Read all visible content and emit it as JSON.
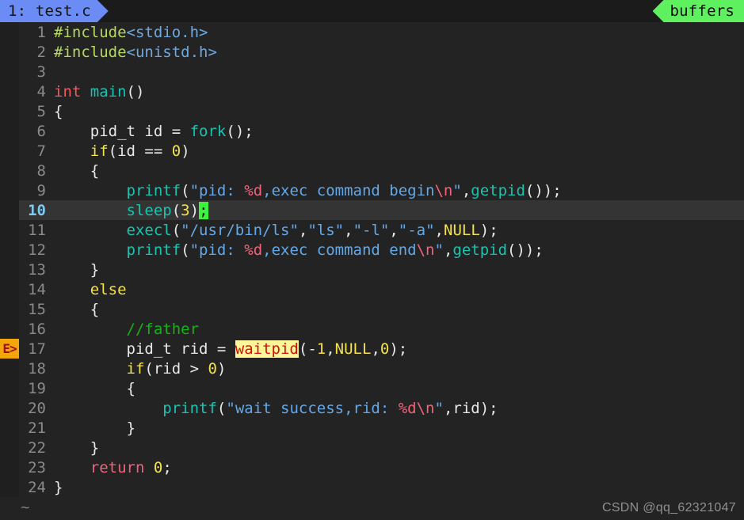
{
  "editor": {
    "name": "vim",
    "colors": {
      "background": "#232323",
      "tabline_background": "#1b1b1b",
      "active_tab": "#6b8cf5",
      "buffers_tab": "#5ff05f",
      "cursor": "#3ff03f",
      "cursorline": "#343434",
      "error_sign_bg": "#f2a60c",
      "error_highlight_bg": "#fff799",
      "error_highlight_fg": "#d01010",
      "line_number": "#8a8a8a",
      "current_line_number": "#7ec8f2"
    }
  },
  "tabline": {
    "active_tab_label": "1: test.c",
    "buffers_label": "buffers"
  },
  "gutter": {
    "error_sign": "E>",
    "error_sign_line": 17,
    "empty_marker": "~"
  },
  "cursor": {
    "line": 10,
    "char": ";"
  },
  "lines": [
    {
      "n": "1",
      "tokens": [
        {
          "t": "#include",
          "c": "s-pre"
        },
        {
          "t": "<stdio.h>",
          "c": "s-header"
        }
      ]
    },
    {
      "n": "2",
      "tokens": [
        {
          "t": "#include",
          "c": "s-pre"
        },
        {
          "t": "<unistd.h>",
          "c": "s-header"
        }
      ]
    },
    {
      "n": "3",
      "tokens": []
    },
    {
      "n": "4",
      "tokens": [
        {
          "t": "int",
          "c": "s-type"
        },
        {
          "t": " ",
          "c": "s-punct"
        },
        {
          "t": "main",
          "c": "s-func"
        },
        {
          "t": "()",
          "c": "s-punct"
        }
      ]
    },
    {
      "n": "5",
      "tokens": [
        {
          "t": "{",
          "c": "s-brace"
        }
      ]
    },
    {
      "n": "6",
      "tokens": [
        {
          "t": "    pid_t id ",
          "c": "s-ident"
        },
        {
          "t": "= ",
          "c": "s-punct"
        },
        {
          "t": "fork",
          "c": "s-func"
        },
        {
          "t": "();",
          "c": "s-punct"
        }
      ]
    },
    {
      "n": "7",
      "tokens": [
        {
          "t": "    ",
          "c": "s-punct"
        },
        {
          "t": "if",
          "c": "s-kw"
        },
        {
          "t": "(id == ",
          "c": "s-punct"
        },
        {
          "t": "0",
          "c": "s-num"
        },
        {
          "t": ")",
          "c": "s-punct"
        }
      ]
    },
    {
      "n": "8",
      "tokens": [
        {
          "t": "    {",
          "c": "s-brace"
        }
      ]
    },
    {
      "n": "9",
      "tokens": [
        {
          "t": "        ",
          "c": "s-punct"
        },
        {
          "t": "printf",
          "c": "s-func"
        },
        {
          "t": "(",
          "c": "s-punct"
        },
        {
          "t": "\"pid: ",
          "c": "s-str"
        },
        {
          "t": "%d",
          "c": "s-fmt"
        },
        {
          "t": ",exec command begin",
          "c": "s-str"
        },
        {
          "t": "\\n",
          "c": "s-fmt"
        },
        {
          "t": "\"",
          "c": "s-str"
        },
        {
          "t": ",",
          "c": "s-punct"
        },
        {
          "t": "getpid",
          "c": "s-func"
        },
        {
          "t": "());",
          "c": "s-punct"
        }
      ]
    },
    {
      "n": "10",
      "cursorline": true,
      "tokens": [
        {
          "t": "        ",
          "c": "s-punct"
        },
        {
          "t": "sleep",
          "c": "s-func"
        },
        {
          "t": "(",
          "c": "s-punct"
        },
        {
          "t": "3",
          "c": "s-num"
        },
        {
          "t": ")",
          "c": "s-punct"
        },
        {
          "t": ";",
          "c": "cursor"
        }
      ]
    },
    {
      "n": "11",
      "tokens": [
        {
          "t": "        ",
          "c": "s-punct"
        },
        {
          "t": "execl",
          "c": "s-func"
        },
        {
          "t": "(",
          "c": "s-punct"
        },
        {
          "t": "\"/usr/bin/ls\"",
          "c": "s-str"
        },
        {
          "t": ",",
          "c": "s-punct"
        },
        {
          "t": "\"ls\"",
          "c": "s-str"
        },
        {
          "t": ",",
          "c": "s-punct"
        },
        {
          "t": "\"-l\"",
          "c": "s-str"
        },
        {
          "t": ",",
          "c": "s-punct"
        },
        {
          "t": "\"-a\"",
          "c": "s-str"
        },
        {
          "t": ",",
          "c": "s-punct"
        },
        {
          "t": "NULL",
          "c": "s-const"
        },
        {
          "t": ");",
          "c": "s-punct"
        }
      ]
    },
    {
      "n": "12",
      "tokens": [
        {
          "t": "        ",
          "c": "s-punct"
        },
        {
          "t": "printf",
          "c": "s-func"
        },
        {
          "t": "(",
          "c": "s-punct"
        },
        {
          "t": "\"pid: ",
          "c": "s-str"
        },
        {
          "t": "%d",
          "c": "s-fmt"
        },
        {
          "t": ",exec command end",
          "c": "s-str"
        },
        {
          "t": "\\n",
          "c": "s-fmt"
        },
        {
          "t": "\"",
          "c": "s-str"
        },
        {
          "t": ",",
          "c": "s-punct"
        },
        {
          "t": "getpid",
          "c": "s-func"
        },
        {
          "t": "());",
          "c": "s-punct"
        }
      ]
    },
    {
      "n": "13",
      "tokens": [
        {
          "t": "    }",
          "c": "s-brace"
        }
      ]
    },
    {
      "n": "14",
      "tokens": [
        {
          "t": "    ",
          "c": "s-punct"
        },
        {
          "t": "else",
          "c": "s-kw"
        }
      ]
    },
    {
      "n": "15",
      "tokens": [
        {
          "t": "    {",
          "c": "s-brace"
        }
      ]
    },
    {
      "n": "16",
      "tokens": [
        {
          "t": "        ",
          "c": "s-punct"
        },
        {
          "t": "//father",
          "c": "s-comment"
        }
      ]
    },
    {
      "n": "17",
      "sign": "E>",
      "tokens": [
        {
          "t": "        pid_t rid ",
          "c": "s-ident"
        },
        {
          "t": "= ",
          "c": "s-punct"
        },
        {
          "t": "waitpid",
          "c": "err-hl"
        },
        {
          "t": "(-",
          "c": "s-punct"
        },
        {
          "t": "1",
          "c": "s-num"
        },
        {
          "t": ",",
          "c": "s-punct"
        },
        {
          "t": "NULL",
          "c": "s-const"
        },
        {
          "t": ",",
          "c": "s-punct"
        },
        {
          "t": "0",
          "c": "s-num"
        },
        {
          "t": ");",
          "c": "s-punct"
        }
      ]
    },
    {
      "n": "18",
      "tokens": [
        {
          "t": "        ",
          "c": "s-punct"
        },
        {
          "t": "if",
          "c": "s-kw"
        },
        {
          "t": "(rid > ",
          "c": "s-punct"
        },
        {
          "t": "0",
          "c": "s-num"
        },
        {
          "t": ")",
          "c": "s-punct"
        }
      ]
    },
    {
      "n": "19",
      "tokens": [
        {
          "t": "        {",
          "c": "s-brace"
        }
      ]
    },
    {
      "n": "20",
      "tokens": [
        {
          "t": "            ",
          "c": "s-punct"
        },
        {
          "t": "printf",
          "c": "s-func"
        },
        {
          "t": "(",
          "c": "s-punct"
        },
        {
          "t": "\"wait success,rid: ",
          "c": "s-str"
        },
        {
          "t": "%d",
          "c": "s-fmt"
        },
        {
          "t": "\\n",
          "c": "s-fmt"
        },
        {
          "t": "\"",
          "c": "s-str"
        },
        {
          "t": ",rid);",
          "c": "s-punct"
        }
      ]
    },
    {
      "n": "21",
      "tokens": [
        {
          "t": "        }",
          "c": "s-brace"
        }
      ]
    },
    {
      "n": "22",
      "tokens": [
        {
          "t": "    }",
          "c": "s-brace"
        }
      ]
    },
    {
      "n": "23",
      "tokens": [
        {
          "t": "    ",
          "c": "s-punct"
        },
        {
          "t": "return",
          "c": "s-ret"
        },
        {
          "t": " ",
          "c": "s-punct"
        },
        {
          "t": "0",
          "c": "s-num"
        },
        {
          "t": ";",
          "c": "s-punct"
        }
      ]
    },
    {
      "n": "24",
      "tokens": [
        {
          "t": "}",
          "c": "s-brace"
        }
      ]
    }
  ],
  "watermark": {
    "text": "CSDN @qq_62321047"
  }
}
